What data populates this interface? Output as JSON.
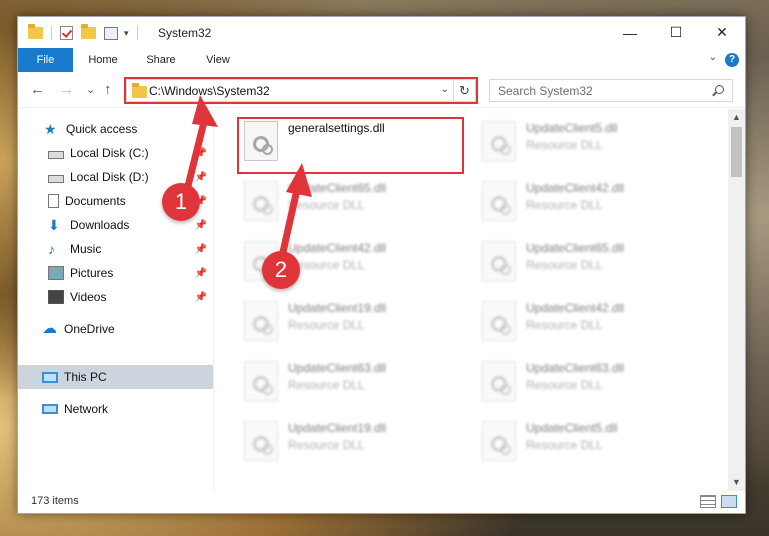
{
  "window": {
    "title": "System32",
    "minimize": "—",
    "maximize": "☐",
    "close": "✕"
  },
  "ribbon": {
    "tabs": [
      "File",
      "Home",
      "Share",
      "View"
    ],
    "help": "?"
  },
  "nav": {
    "back": "←",
    "forward": "→",
    "recent": "⌄",
    "up": "↑",
    "address": "C:\\Windows\\System32",
    "dropdown": "⌄",
    "refresh": "↻"
  },
  "search": {
    "placeholder": "Search System32"
  },
  "sidebar": {
    "items": [
      {
        "label": "Quick access",
        "icon": "star-icon"
      },
      {
        "label": "Local Disk (C:)",
        "icon": "drive-icon",
        "pin": "📌"
      },
      {
        "label": "Local Disk (D:)",
        "icon": "drive-icon",
        "pin": "📌"
      },
      {
        "label": "Documents",
        "icon": "documents-icon",
        "pin": "📌"
      },
      {
        "label": "Downloads",
        "icon": "downloads-icon",
        "pin": "📌"
      },
      {
        "label": "Music",
        "icon": "music-icon",
        "pin": "📌"
      },
      {
        "label": "Pictures",
        "icon": "pictures-icon",
        "pin": "📌"
      },
      {
        "label": "Videos",
        "icon": "videos-icon",
        "pin": "📌"
      },
      {
        "label": "OneDrive",
        "icon": "cloud-icon"
      },
      {
        "label": "This PC",
        "icon": "computer-icon",
        "selected": true
      },
      {
        "label": "Network",
        "icon": "network-icon"
      }
    ]
  },
  "files": [
    {
      "name": "generalsettings.dll",
      "type": "",
      "focus": true
    },
    {
      "name": "UpdateClient5.dll",
      "type": "Resource DLL"
    },
    {
      "name": "UpdateClient65.dll",
      "type": "Resource DLL"
    },
    {
      "name": "UpdateClient42.dll",
      "type": "Resource DLL"
    },
    {
      "name": "UpdateClient42.dll",
      "type": "Resource DLL"
    },
    {
      "name": "UpdateClient65.dll",
      "type": "Resource DLL"
    },
    {
      "name": "UpdateClient19.dll",
      "type": "Resource DLL"
    },
    {
      "name": "UpdateClient42.dll",
      "type": "Resource DLL"
    },
    {
      "name": "UpdateClient63.dll",
      "type": "Resource DLL"
    },
    {
      "name": "UpdateClient63.dll",
      "type": "Resource DLL"
    },
    {
      "name": "UpdateClient19.dll",
      "type": "Resource DLL"
    },
    {
      "name": "UpdateClient5.dll",
      "type": "Resource DLL"
    }
  ],
  "status": {
    "items": "173 items"
  },
  "annotations": {
    "step1": "1",
    "step2": "2",
    "color": "#e0343b"
  }
}
